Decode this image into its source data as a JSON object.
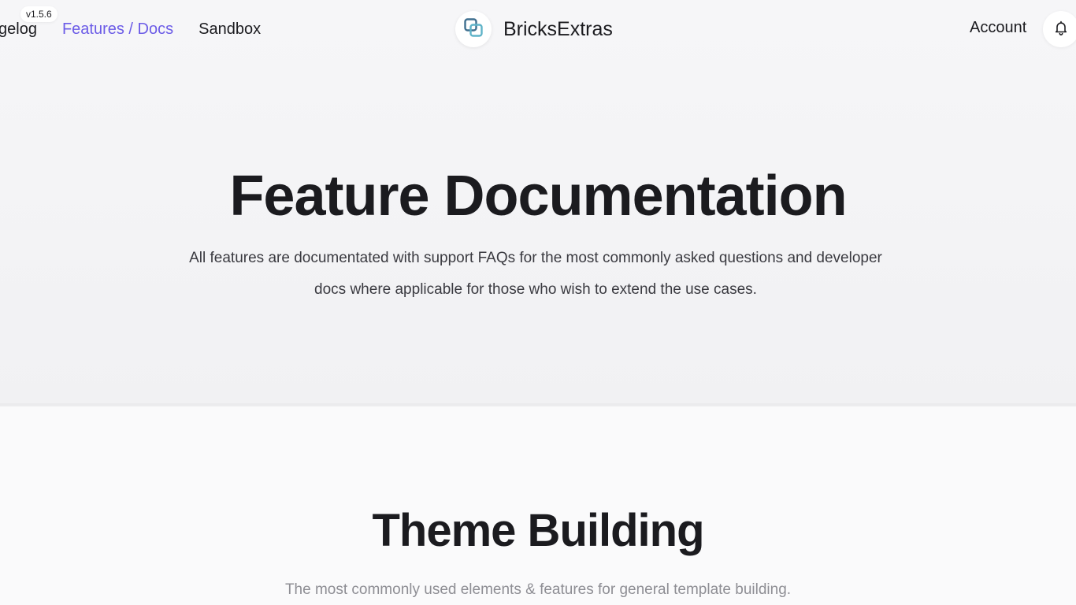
{
  "header": {
    "version_badge": "v1.5.6",
    "nav": {
      "changelog_label": "gelog",
      "features_label": "Features / Docs",
      "sandbox_label": "Sandbox"
    },
    "brand_name": "BricksExtras",
    "account_label": "Account",
    "icons": {
      "logo": "overlapping-squares-logo-icon",
      "notifications": "bell-icon"
    }
  },
  "hero": {
    "title": "Feature Documentation",
    "description": "All features are documentated with support FAQs for the most commonly asked questions and developer docs where applicable for those who wish to extend the use cases."
  },
  "section": {
    "title": "Theme Building",
    "description": "The most commonly used elements & features for general template building."
  },
  "colors": {
    "accent": "#6c5ce7",
    "text": "#1b1b1f",
    "muted": "#8e8e94",
    "logo_primary": "#3f6f8f",
    "logo_secondary": "#5fb3c8"
  }
}
